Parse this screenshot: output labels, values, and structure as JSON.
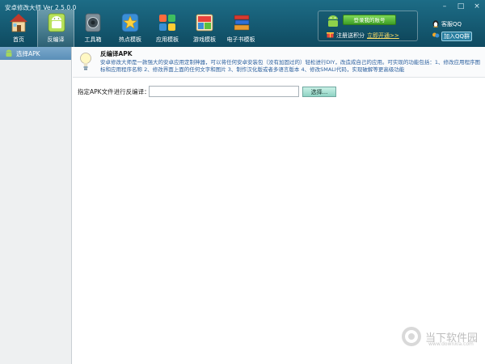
{
  "window": {
    "title": "安卓修改大师 Ver 2.5.0.0",
    "controls": [
      "–",
      "□",
      "×"
    ]
  },
  "toolbar": {
    "items": [
      {
        "label": "首页",
        "icon": "home-icon",
        "active": false
      },
      {
        "label": "反编译",
        "icon": "android-icon",
        "active": true
      },
      {
        "label": "工具箱",
        "icon": "speaker-icon",
        "active": false
      },
      {
        "label": "热点模板",
        "icon": "star-icon",
        "active": false
      },
      {
        "label": "应用模板",
        "icon": "apps-grid-icon",
        "active": false
      },
      {
        "label": "游戏模板",
        "icon": "game-icon",
        "active": false
      },
      {
        "label": "电子书模板",
        "icon": "books-icon",
        "active": false
      }
    ]
  },
  "promo": {
    "login_label": "登录我的账号",
    "register_text": "注册送积分",
    "activate_link": "立即开通>>"
  },
  "qq": {
    "service_label": "客服QQ",
    "group_label": "加入QQ群"
  },
  "sidebar": {
    "items": [
      {
        "label": "选择APK",
        "icon": "android-icon"
      }
    ]
  },
  "info": {
    "title": "反编译APK",
    "description": "安卓修改大师是一款强大的安卓应用定制神器，可以将任何安卓安装包（没有加固过的）轻松进行DIY，改造成自己的应用。可实现的功能包括：1、修改应用程序图标和应用程序名称 2、修改界面上面的任何文字和图片 3、制作汉化版或者多语言版本 4、修改SMALI代码，实现破解等更高级功能"
  },
  "form": {
    "label": "指定APK文件进行反编译：",
    "input_value": "",
    "input_placeholder": "",
    "select_button": "选择..."
  },
  "watermark": {
    "text": "当下软件园",
    "url": "www.downxia.com"
  }
}
